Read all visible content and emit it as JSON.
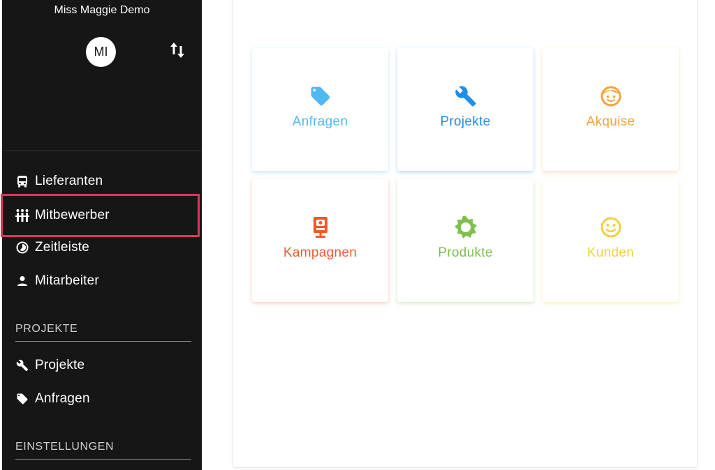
{
  "sidebar": {
    "title": "Miss Maggie Demo",
    "avatar_initials": "MI",
    "switch_icon": "swap-vertical-icon",
    "items": [
      {
        "label": "Lieferanten",
        "icon": "bus-icon"
      },
      {
        "label": "Mitbewerber",
        "icon": "people-group-icon",
        "highlighted": true
      },
      {
        "label": "Zeitleiste",
        "icon": "timelapse-icon"
      },
      {
        "label": "Mitarbeiter",
        "icon": "person-icon"
      }
    ],
    "section_projekte": "PROJEKTE",
    "projekte_items": [
      {
        "label": "Projekte",
        "icon": "wrench-icon"
      },
      {
        "label": "Anfragen",
        "icon": "tag-icon"
      }
    ],
    "section_einstellungen": "EINSTELLUNGEN"
  },
  "tiles": [
    {
      "label": "Anfragen",
      "icon": "tag-icon",
      "color": "#4fb8ee"
    },
    {
      "label": "Projekte",
      "icon": "wrench-icon",
      "color": "#1f8ee8"
    },
    {
      "label": "Akquise",
      "icon": "child-face-icon",
      "color": "#f5a23a"
    },
    {
      "label": "Kampagnen",
      "icon": "campaign-board-icon",
      "color": "#f5572b"
    },
    {
      "label": "Produkte",
      "icon": "gear-sun-icon",
      "color": "#7ec04c"
    },
    {
      "label": "Kunden",
      "icon": "smiley-icon",
      "color": "#f2d03b"
    }
  ],
  "colors": {
    "sidebar_bg": "#161616",
    "highlight_border": "#d6395a"
  }
}
